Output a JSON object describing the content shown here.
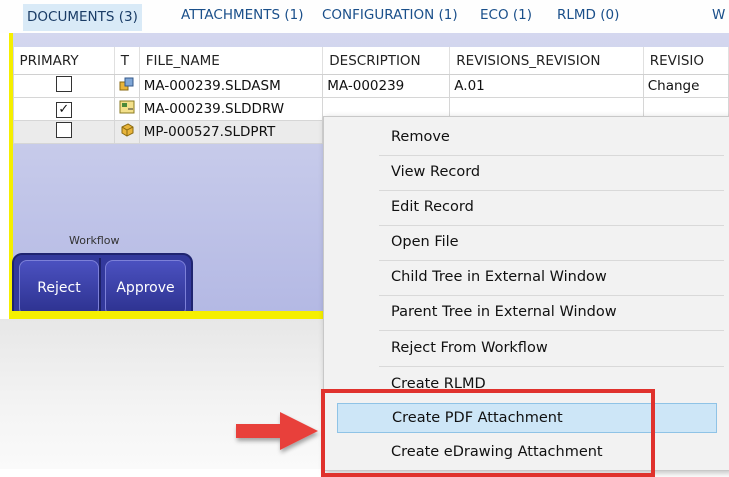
{
  "tabs": [
    {
      "label": "DOCUMENTS (3)"
    },
    {
      "label": "ATTACHMENTS (1)"
    },
    {
      "label": "CONFIGURATION (1)"
    },
    {
      "label": "ECO (1)"
    },
    {
      "label": "RLMD (0)"
    },
    {
      "label": "W"
    }
  ],
  "grid": {
    "columns": [
      "PRIMARY",
      "T",
      "FILE_NAME",
      "DESCRIPTION",
      "REVISIONS_REVISION",
      "REVISIO"
    ],
    "rows": [
      {
        "primary_checked": false,
        "type_icon": "assembly-icon",
        "file_name": "MA-000239.SLDASM",
        "description": "MA-000239",
        "revision": "A.01",
        "revisio": "Change"
      },
      {
        "primary_checked": true,
        "type_icon": "drawing-icon",
        "file_name": "MA-000239.SLDDRW",
        "description": "",
        "revision": "",
        "revisio": ""
      },
      {
        "primary_checked": false,
        "type_icon": "part-icon",
        "file_name": "MP-000527.SLDPRT",
        "description": "",
        "revision": "",
        "revisio": ""
      }
    ]
  },
  "workflow": {
    "label": "Workflow",
    "reject_label": "Reject",
    "approve_label": "Approve"
  },
  "context_menu": {
    "items": [
      {
        "label": "Remove"
      },
      {
        "label": "View Record"
      },
      {
        "label": "Edit Record"
      },
      {
        "label": "Open File"
      },
      {
        "label": "Child Tree in External Window"
      },
      {
        "label": "Parent Tree in External Window"
      },
      {
        "label": "Reject From Workflow"
      },
      {
        "label": "Create RLMD"
      },
      {
        "label": "Create PDF Attachment",
        "highlighted": true
      },
      {
        "label": "Create eDrawing Attachment"
      }
    ]
  },
  "check_mark": "✓",
  "colors": {
    "frame": "#f5ef00",
    "workflow_bg": "#33399c",
    "highlight": "#cde6f7",
    "annotation": "#e0322d"
  }
}
